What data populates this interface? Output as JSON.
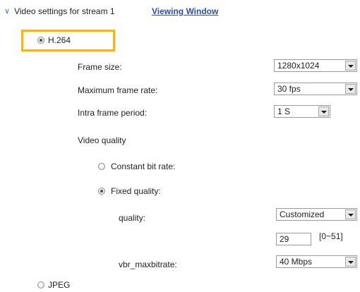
{
  "header": {
    "section_title": "Video settings for stream 1",
    "viewing_link": "Viewing Window"
  },
  "codec": {
    "h264_label": "H.264",
    "jpeg_label": "JPEG",
    "selected": "H.264"
  },
  "h264": {
    "frame_size": {
      "label": "Frame size:",
      "value": "1280x1024"
    },
    "max_frame_rate": {
      "label": "Maximum frame rate:",
      "value": "30 fps"
    },
    "intra_frame_period": {
      "label": "Intra frame period:",
      "value": "1 S"
    },
    "video_quality": {
      "label": "Video quality",
      "constant_bit_rate_label": "Constant bit rate:",
      "fixed_quality_label": "Fixed quality:",
      "selected": "Fixed quality",
      "quality": {
        "label": "quality:",
        "value": "Customized",
        "custom_value": "29",
        "range_hint": "[0~51]"
      },
      "vbr_maxbitrate": {
        "label": "vbr_maxbitrate:",
        "value": "40 Mbps"
      }
    }
  },
  "colors": {
    "highlight": "#f0b428",
    "link": "#2a4fb8",
    "chevron": "#3a74c7"
  }
}
